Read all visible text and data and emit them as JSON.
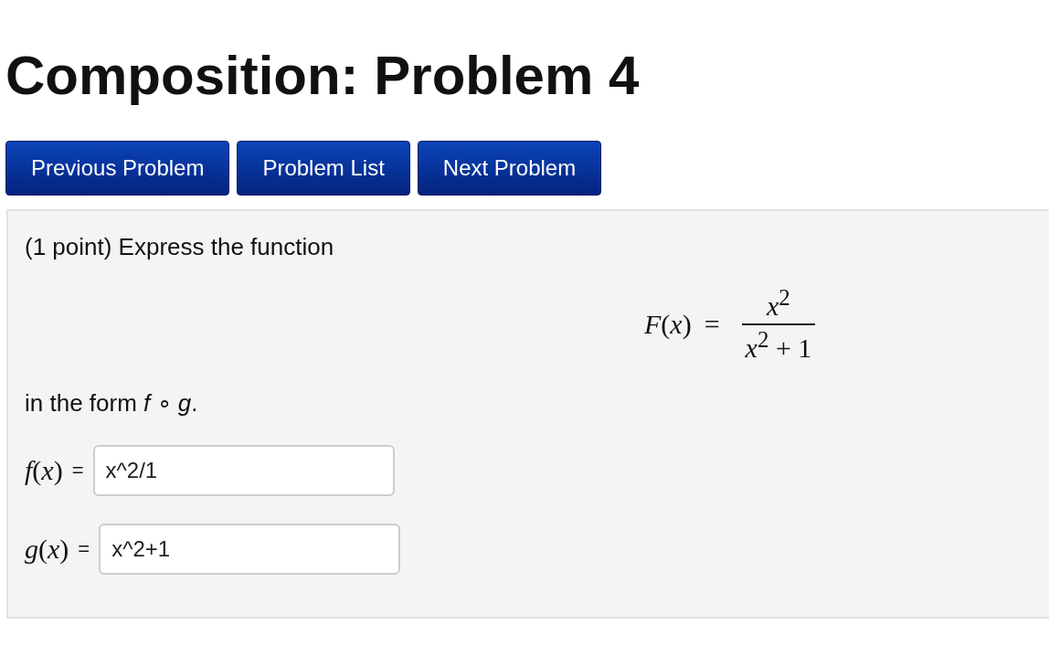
{
  "title": "Composition: Problem 4",
  "nav_buttons": [
    {
      "label": "Previous Problem"
    },
    {
      "label": "Problem List"
    },
    {
      "label": "Next Problem"
    }
  ],
  "problem": {
    "intro": "(1 point) Express the function",
    "formula": {
      "lhs": "*F*(*x*)",
      "equals": "=",
      "numerator": "*x*$^{2}$",
      "denominator": "*x*$^{2}$ + 1"
    },
    "instruction": "in the form *f* ∘ *g*.",
    "answers": [
      {
        "label": "*f*(*x*)",
        "equals": "=",
        "value": "x^2/1"
      },
      {
        "label": "*g*(*x*)",
        "equals": "=",
        "value": "x^2+1"
      }
    ]
  }
}
